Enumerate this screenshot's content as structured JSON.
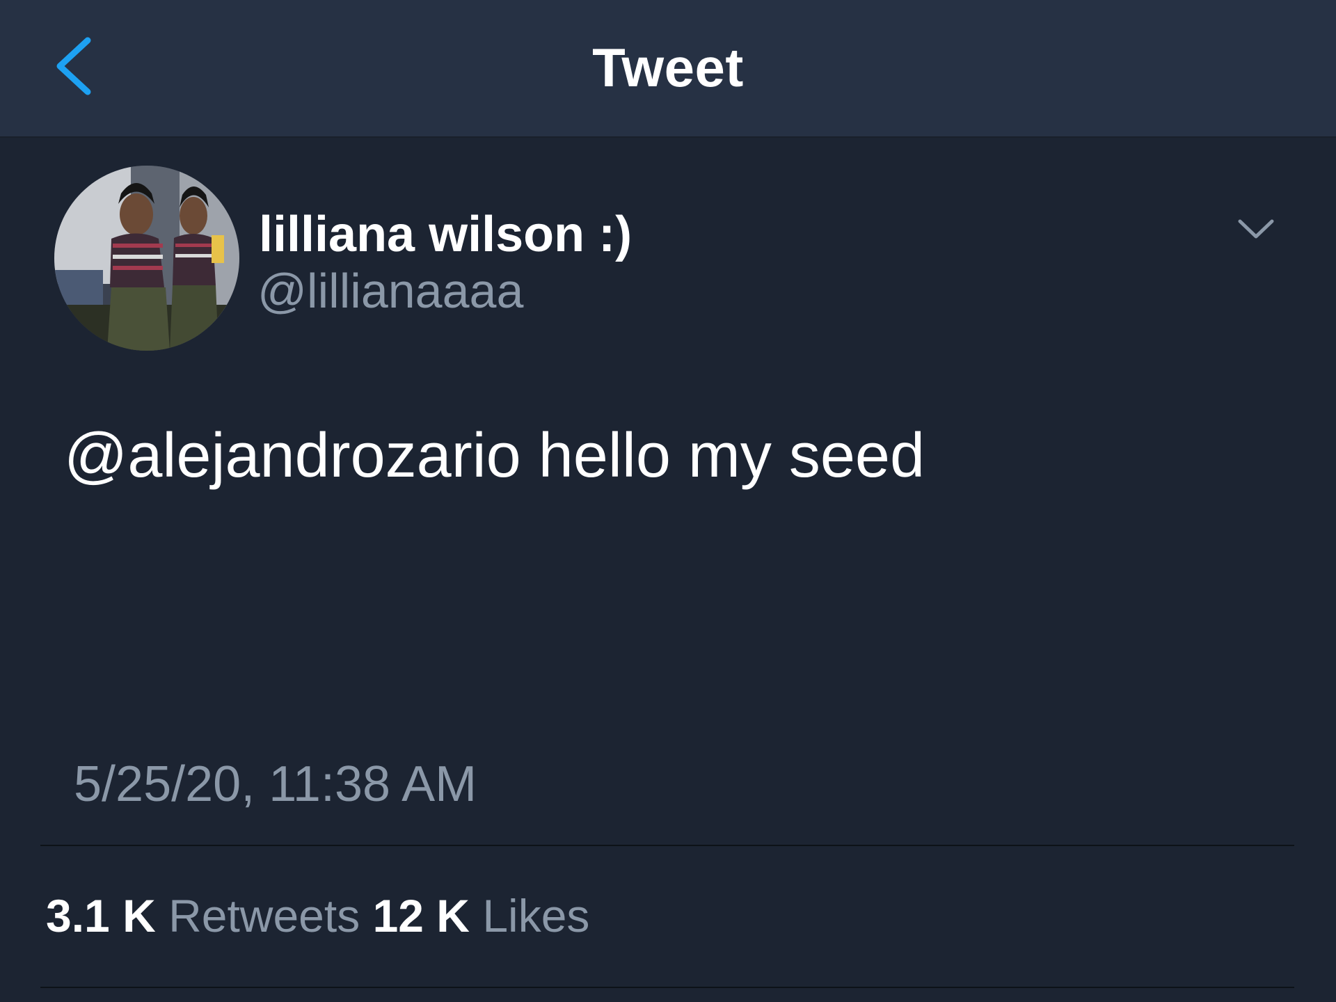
{
  "nav": {
    "title": "Tweet",
    "back_icon": "chevron-left-icon",
    "accent_color": "#1da1f2"
  },
  "author": {
    "display_name": "lilliana wilson :)",
    "handle": "@lillianaaaa",
    "avatar": "profile-photo"
  },
  "tweet": {
    "mention": "@alejandrozario",
    "text": " hello my seed",
    "timestamp": "5/25/20, 11:38 AM",
    "menu_icon": "chevron-down-icon"
  },
  "stats": {
    "retweets_count": "3.1 K",
    "retweets_label": "Retweets",
    "likes_count": "12 K",
    "likes_label": "Likes"
  },
  "colors": {
    "background": "#1c2432",
    "nav_background": "#263144",
    "secondary_text": "#8b98a8"
  }
}
